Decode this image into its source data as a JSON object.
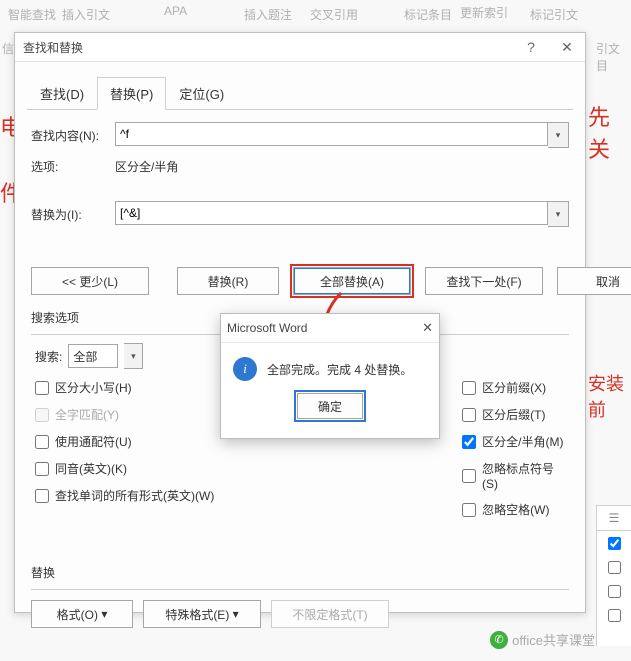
{
  "ribbon": {
    "bg1": "智能查找",
    "bg2": "插入引文",
    "bg3": "APA",
    "bg4": "插入题注",
    "bg5": "交叉引用",
    "bg6": "标记条目",
    "bg7": "更新索引",
    "bg8": "标记引文",
    "bg9": "引文目",
    "bg10": "信息"
  },
  "dialog": {
    "title": "查找和替换",
    "help": "?",
    "close": "✕",
    "tabs": {
      "find": "查找(D)",
      "replace": "替换(P)",
      "goto": "定位(G)"
    },
    "find_label": "查找内容(N):",
    "find_value": "^f",
    "options_label": "选项:",
    "options_value": "区分全/半角",
    "replace_label": "替换为(I):",
    "replace_value": "[^&]",
    "buttons": {
      "less": "<< 更少(L)",
      "replace_one": "替换(R)",
      "replace_all": "全部替换(A)",
      "find_next": "查找下一处(F)",
      "cancel": "取消"
    },
    "search_options_title": "搜索选项",
    "search_label": "搜索:",
    "search_scope": "全部",
    "checks_left": [
      {
        "label": "区分大小写(H)",
        "checked": false,
        "disabled": false
      },
      {
        "label": "全字匹配(Y)",
        "checked": false,
        "disabled": true
      },
      {
        "label": "使用通配符(U)",
        "checked": false,
        "disabled": false
      },
      {
        "label": "同音(英文)(K)",
        "checked": false,
        "disabled": false
      },
      {
        "label": "查找单词的所有形式(英文)(W)",
        "checked": false,
        "disabled": false
      }
    ],
    "checks_right": [
      {
        "label": "区分前缀(X)",
        "checked": false
      },
      {
        "label": "区分后缀(T)",
        "checked": false
      },
      {
        "label": "区分全/半角(M)",
        "checked": true
      },
      {
        "label": "忽略标点符号(S)",
        "checked": false
      },
      {
        "label": "忽略空格(W)",
        "checked": false
      }
    ],
    "bottom_title": "替换",
    "bottom_buttons": {
      "format": "格式(O)",
      "special": "特殊格式(E)",
      "noformat": "不限定格式(T)"
    }
  },
  "msgbox": {
    "title": "Microsoft Word",
    "close": "✕",
    "text": "全部完成。完成 4 处替换。",
    "ok": "确定"
  },
  "bg_red": {
    "t1": "电",
    "t2": "件",
    "t3": "先关",
    "t4": "安装前"
  },
  "watermark": "office共享课堂",
  "side_icon": "☰"
}
